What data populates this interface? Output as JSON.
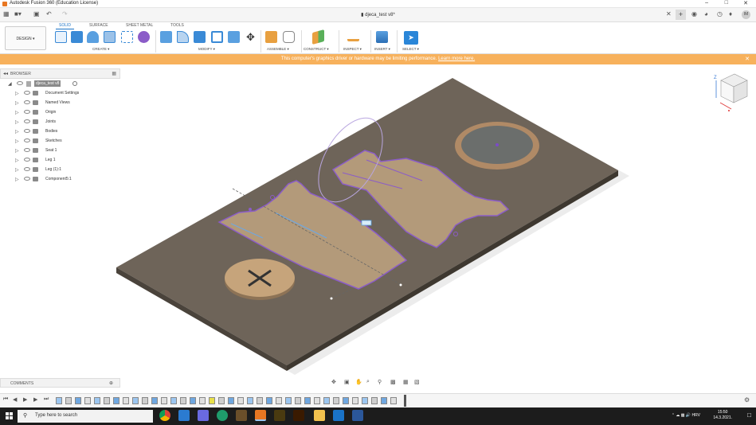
{
  "window": {
    "title": "Autodesk Fusion 360 (Education License)"
  },
  "document": {
    "tab_title": "djeca_test v8*"
  },
  "workspace": {
    "label": "DESIGN ▾"
  },
  "tabs": [
    "SOLID",
    "SURFACE",
    "SHEET METAL",
    "TOOLS"
  ],
  "active_tab": "SOLID",
  "groups": {
    "create": "CREATE ▾",
    "modify": "MODIFY ▾",
    "assemble": "ASSEMBLE ▾",
    "construct": "CONSTRUCT ▾",
    "inspect": "INSPECT ▾",
    "insert": "INSERT ▾",
    "select": "SELECT ▾"
  },
  "banner": {
    "message": "This computer's graphics driver or hardware may be limiting performance.",
    "link": "Learn more here.",
    "color": "#f7b15c"
  },
  "browser": {
    "title": "BROWSER",
    "root": "djeca_test v8",
    "items": [
      {
        "label": "Document Settings"
      },
      {
        "label": "Named Views"
      },
      {
        "label": "Origin"
      },
      {
        "label": "Joints"
      },
      {
        "label": "Bodies"
      },
      {
        "label": "Sketches"
      },
      {
        "label": "Seat 1"
      },
      {
        "label": "Leg 1"
      },
      {
        "label": "Leg (1):1"
      },
      {
        "label": "Component5:1"
      }
    ]
  },
  "comments": {
    "title": "COMMENTS"
  },
  "viewcube": {
    "axis_label": "Z"
  },
  "taskbar": {
    "search_placeholder": "Type here to search",
    "language": "HRV",
    "time": "15:50",
    "date": "14.3.2021."
  }
}
